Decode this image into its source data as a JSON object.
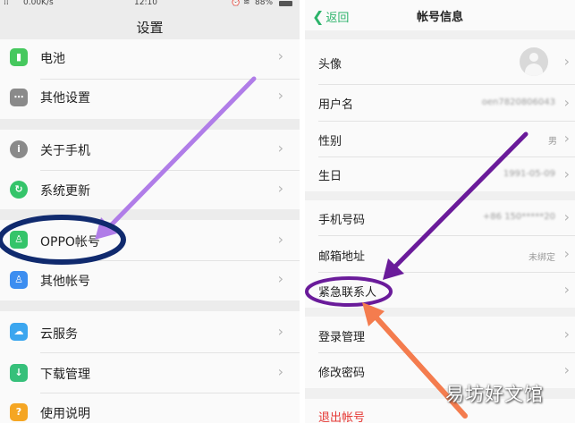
{
  "left": {
    "status": {
      "speed": "0.00K/s",
      "time": "12:10",
      "battery": "88%"
    },
    "title": "设置",
    "items": [
      {
        "label": "电池",
        "icon": "battery-icon",
        "color": "#46c85e"
      },
      {
        "label": "其他设置",
        "icon": "more-settings-icon",
        "color": "#8a8a8a"
      },
      {
        "label": "关于手机",
        "icon": "info-icon",
        "color": "#8a8a8a"
      },
      {
        "label": "系统更新",
        "icon": "system-update-icon",
        "color": "#35c46a"
      },
      {
        "label": "OPPO帐号",
        "icon": "user-icon",
        "color": "#35c46a"
      },
      {
        "label": "其他帐号",
        "icon": "account-icon",
        "color": "#3d8ef0"
      },
      {
        "label": "云服务",
        "icon": "cloud-icon",
        "color": "#3ba6ef"
      },
      {
        "label": "下载管理",
        "icon": "download-icon",
        "color": "#36c07a"
      },
      {
        "label": "使用说明",
        "icon": "guide-icon",
        "color": "#f5a623"
      }
    ]
  },
  "right": {
    "back_label": "返回",
    "title": "帐号信息",
    "rows": [
      {
        "label": "头像",
        "value": ""
      },
      {
        "label": "用户名",
        "value": "oen7820806043"
      },
      {
        "label": "性别",
        "value": "男"
      },
      {
        "label": "生日",
        "value": "1991-05-09"
      },
      {
        "label": "手机号码",
        "value": "+86 150*****20"
      },
      {
        "label": "邮箱地址",
        "value": "未绑定"
      },
      {
        "label": "紧急联系人",
        "value": ""
      },
      {
        "label": "登录管理",
        "value": ""
      },
      {
        "label": "修改密码",
        "value": ""
      },
      {
        "label": "退出帐号",
        "value": ""
      }
    ],
    "logout_color": "#e53935"
  },
  "watermark": "易坊好文馆",
  "annotation_colors": {
    "highlight_left": "#102a6e",
    "arrow_left": "#b07de8",
    "highlight_right": "#6a1b9a",
    "arrow_right_orange": "#f47c4e"
  },
  "chevron": "›"
}
